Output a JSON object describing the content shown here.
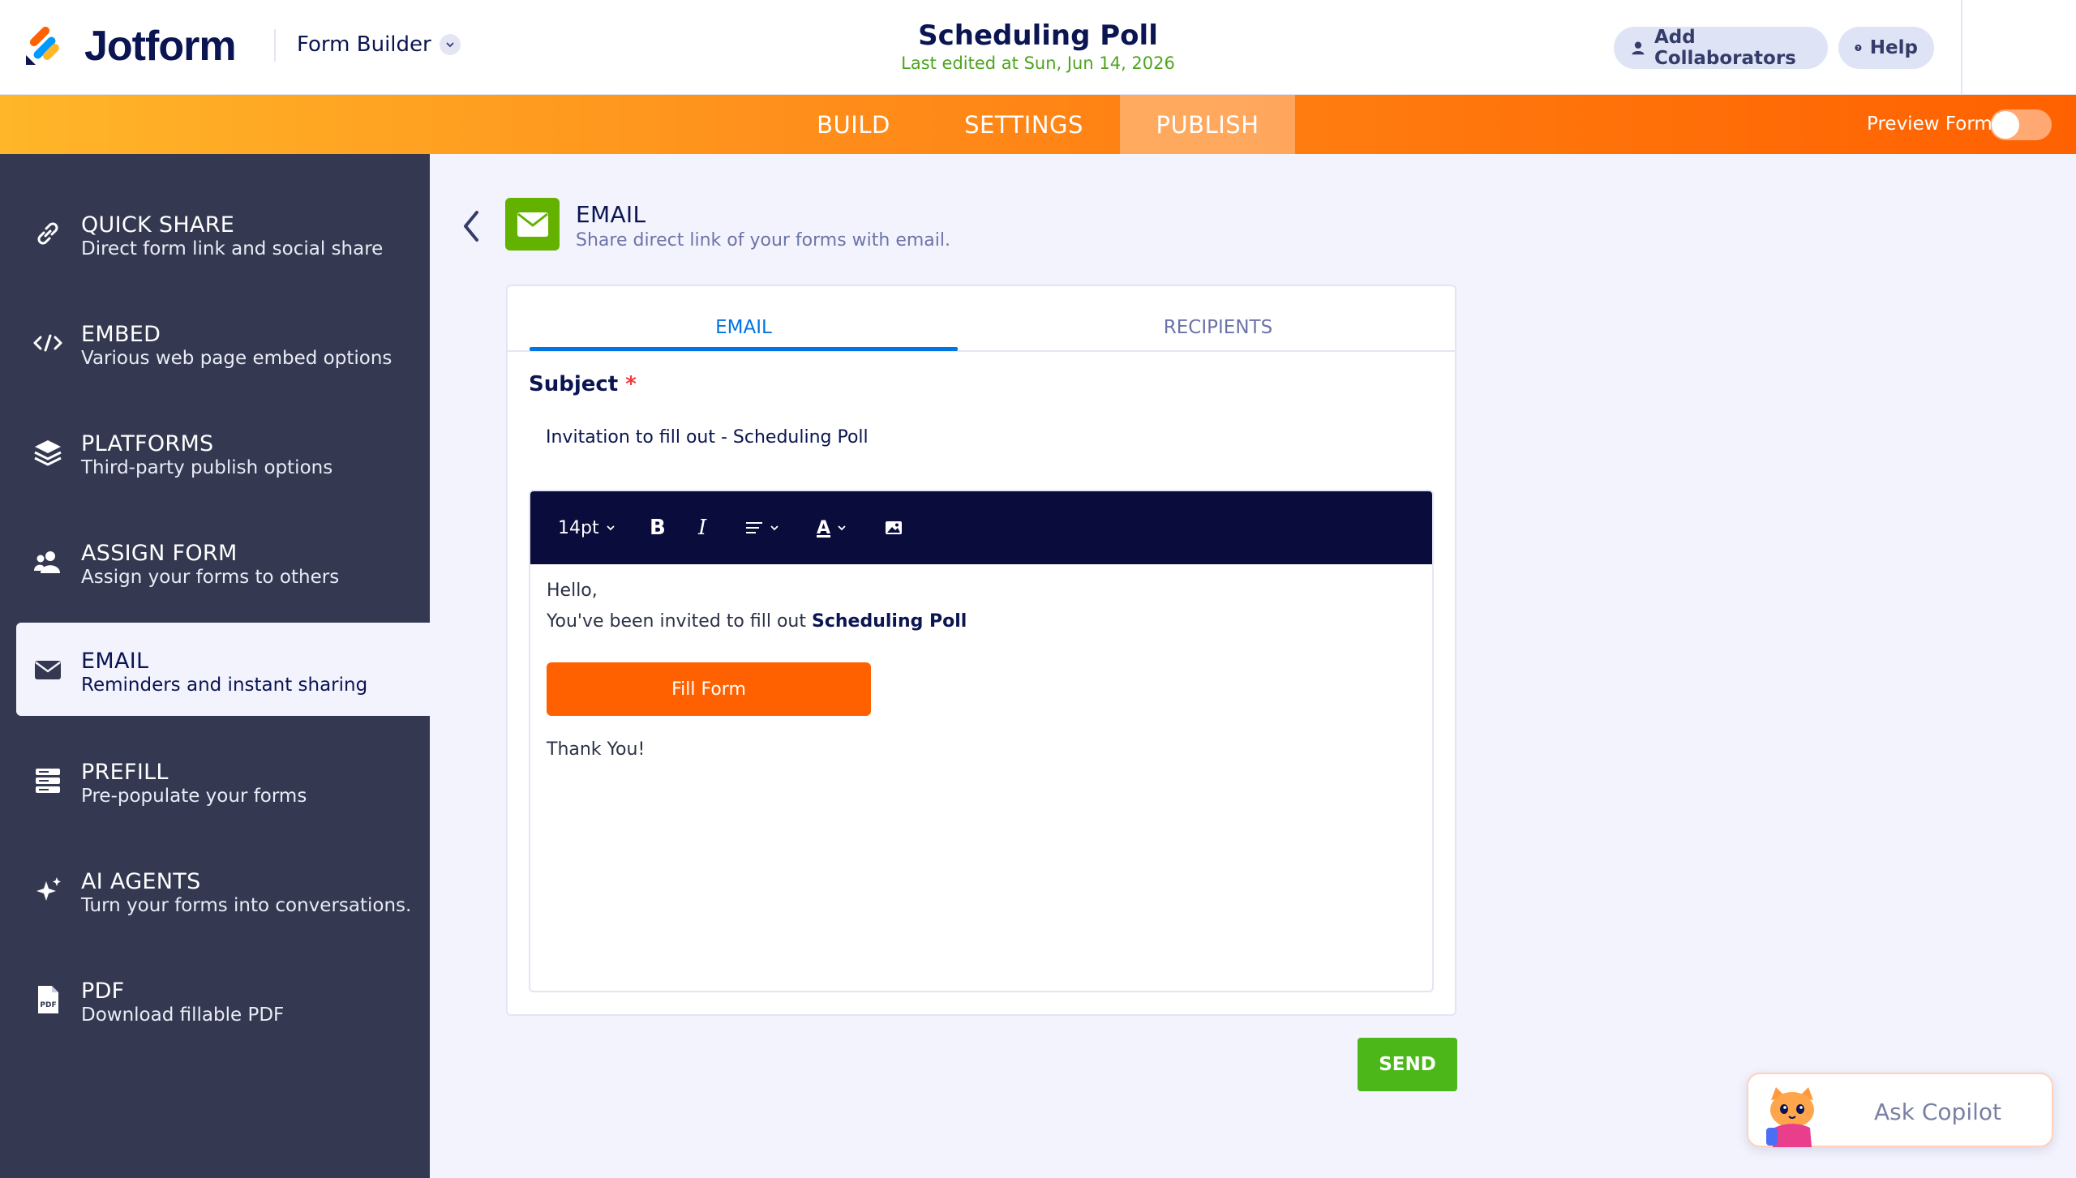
{
  "app": {
    "brand": "Jotform",
    "builder_label": "Form Builder",
    "form_title": "Scheduling Poll",
    "last_edited": "Last edited at Sun, Jun 14, 2026",
    "collaborators_label": "Add Collaborators",
    "help_label": "Help"
  },
  "nav": {
    "tabs": [
      {
        "label": "BUILD"
      },
      {
        "label": "SETTINGS"
      },
      {
        "label": "PUBLISH",
        "active": true
      }
    ],
    "preview_label": "Preview Form",
    "preview_on": false
  },
  "sidebar": {
    "items": [
      {
        "icon": "link-icon",
        "title": "QUICK SHARE",
        "desc": "Direct form link and social share"
      },
      {
        "icon": "code-icon",
        "title": "EMBED",
        "desc": "Various web page embed options"
      },
      {
        "icon": "layers-icon",
        "title": "PLATFORMS",
        "desc": "Third-party publish options"
      },
      {
        "icon": "users-icon",
        "title": "ASSIGN FORM",
        "desc": "Assign your forms to others"
      },
      {
        "icon": "envelope-icon",
        "title": "EMAIL",
        "desc": "Reminders and instant sharing",
        "active": true
      },
      {
        "icon": "stack-icon",
        "title": "PREFILL",
        "desc": "Pre-populate your forms"
      },
      {
        "icon": "sparkle-icon",
        "title": "AI AGENTS",
        "desc": "Turn your forms into conversations."
      },
      {
        "icon": "pdf-icon",
        "title": "PDF",
        "desc": "Download fillable PDF"
      }
    ]
  },
  "main": {
    "title": "EMAIL",
    "description": "Share direct link of your forms with email.",
    "tabs": [
      {
        "label": "EMAIL",
        "active": true
      },
      {
        "label": "RECIPIENTS"
      }
    ],
    "subject_label": "Subject",
    "subject_required": "*",
    "subject_value": "Invitation to fill out - Scheduling Poll",
    "toolbar": {
      "font_size": "14pt",
      "bold": "B",
      "italic": "I",
      "text_color": "A"
    },
    "body": {
      "greeting": "Hello,",
      "invite_prefix": "You've been invited to fill out ",
      "invite_form": "Scheduling Poll",
      "button_label": "Fill Form",
      "closing": "Thank You!"
    },
    "send_label": "SEND"
  },
  "copilot": {
    "label": "Ask Copilot"
  },
  "colors": {
    "accent_orange": "#ff6100",
    "accent_blue": "#0075e3",
    "send_green": "#4bb718",
    "email_tile": "#64b200",
    "edited_green": "#4fa41f",
    "sidebar_bg": "#343951",
    "toolbar_bg": "#0a0c3b"
  }
}
